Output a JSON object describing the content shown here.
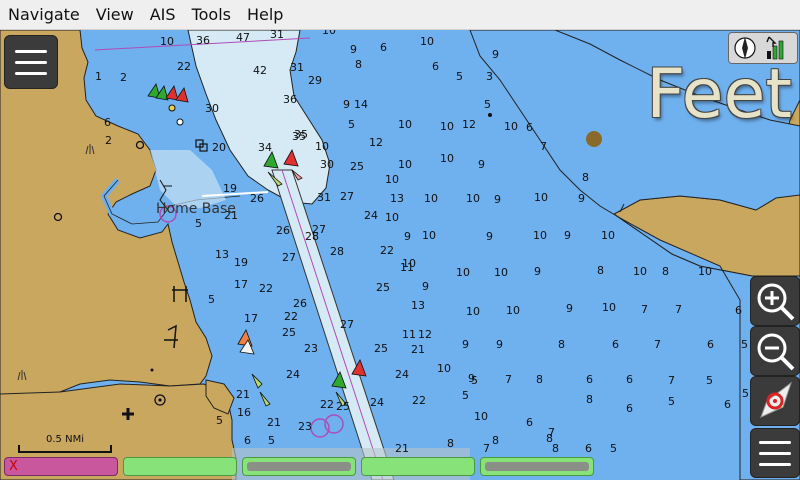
{
  "menu": [
    "Navigate",
    "View",
    "AIS",
    "Tools",
    "Help"
  ],
  "units_overlay": "Feet",
  "scale_label": "0.5 NMi",
  "place_label": "Home Base",
  "piano_close": "X",
  "colors": {
    "deep_water": "#6fb0ee",
    "shallow_water": "#d6eaf5",
    "land": "#c9a75e",
    "piano_magenta": "#c8579e",
    "piano_green": "#88e27a"
  },
  "soundings": [
    [
      "10",
      160,
      45
    ],
    [
      "36",
      196,
      44
    ],
    [
      "47",
      236,
      41
    ],
    [
      "31",
      270,
      38
    ],
    [
      "10",
      322,
      34
    ],
    [
      "9",
      350,
      53
    ],
    [
      "6",
      380,
      51
    ],
    [
      "10",
      420,
      45
    ],
    [
      "6",
      432,
      70
    ],
    [
      "5",
      456,
      80
    ],
    [
      "3",
      486,
      80
    ],
    [
      "5",
      484,
      108
    ],
    [
      "9",
      492,
      58
    ],
    [
      "42",
      253,
      74
    ],
    [
      "31",
      290,
      71
    ],
    [
      "29",
      308,
      84
    ],
    [
      "8",
      355,
      68
    ],
    [
      "22",
      177,
      70
    ],
    [
      "1",
      95,
      80
    ],
    [
      "2",
      120,
      81
    ],
    [
      "36",
      283,
      103
    ],
    [
      "9",
      343,
      108
    ],
    [
      "14",
      354,
      108
    ],
    [
      "5",
      348,
      128
    ],
    [
      "10",
      398,
      128
    ],
    [
      "10",
      440,
      130
    ],
    [
      "12",
      462,
      128
    ],
    [
      "10",
      504,
      130
    ],
    [
      "6",
      526,
      131
    ],
    [
      "30",
      205,
      112
    ],
    [
      "20",
      212,
      151
    ],
    [
      "35",
      292,
      140
    ],
    [
      "35",
      294,
      138
    ],
    [
      "34",
      258,
      151
    ],
    [
      "30",
      320,
      168
    ],
    [
      "10",
      315,
      150
    ],
    [
      "12",
      369,
      146
    ],
    [
      "7",
      540,
      150
    ],
    [
      "25",
      350,
      170
    ],
    [
      "10",
      398,
      168
    ],
    [
      "10",
      385,
      183
    ],
    [
      "8",
      582,
      181
    ],
    [
      "9",
      478,
      168
    ],
    [
      "10",
      440,
      162
    ],
    [
      "2",
      105,
      144
    ],
    [
      "6",
      104,
      126
    ],
    [
      "19",
      223,
      192
    ],
    [
      "26",
      250,
      202
    ],
    [
      "31",
      317,
      201
    ],
    [
      "27",
      340,
      200
    ],
    [
      "13",
      390,
      202
    ],
    [
      "10",
      424,
      202
    ],
    [
      "10",
      466,
      202
    ],
    [
      "9",
      494,
      203
    ],
    [
      "10",
      534,
      201
    ],
    [
      "9",
      578,
      202
    ],
    [
      "24",
      364,
      219
    ],
    [
      "10",
      385,
      221
    ],
    [
      "5",
      195,
      227
    ],
    [
      "21",
      224,
      219
    ],
    [
      "26",
      276,
      234
    ],
    [
      "27",
      312,
      233
    ],
    [
      "28",
      305,
      240
    ],
    [
      "22",
      380,
      254
    ],
    [
      "9",
      404,
      240
    ],
    [
      "10",
      422,
      239
    ],
    [
      "9",
      486,
      240
    ],
    [
      "10",
      533,
      239
    ],
    [
      "9",
      564,
      239
    ],
    [
      "10",
      601,
      239
    ],
    [
      "13",
      215,
      258
    ],
    [
      "19",
      234,
      266
    ],
    [
      "27",
      282,
      261
    ],
    [
      "28",
      330,
      255
    ],
    [
      "10",
      402,
      267
    ],
    [
      "10",
      456,
      276
    ],
    [
      "10",
      494,
      276
    ],
    [
      "9",
      534,
      275
    ],
    [
      "8",
      597,
      274
    ],
    [
      "10",
      633,
      275
    ],
    [
      "8",
      662,
      275
    ],
    [
      "10",
      698,
      275
    ],
    [
      "17",
      234,
      288
    ],
    [
      "22",
      259,
      292
    ],
    [
      "25",
      376,
      291
    ],
    [
      "11",
      400,
      271
    ],
    [
      "13",
      411,
      309
    ],
    [
      "9",
      422,
      290
    ],
    [
      "10",
      466,
      315
    ],
    [
      "10",
      506,
      314
    ],
    [
      "9",
      566,
      312
    ],
    [
      "10",
      602,
      311
    ],
    [
      "7",
      641,
      313
    ],
    [
      "7",
      675,
      313
    ],
    [
      "6",
      735,
      314
    ],
    [
      "5",
      208,
      303
    ],
    [
      "26",
      293,
      307
    ],
    [
      "17",
      244,
      322
    ],
    [
      "22",
      284,
      320
    ],
    [
      "25",
      282,
      336
    ],
    [
      "23",
      304,
      352
    ],
    [
      "27",
      340,
      328
    ],
    [
      "11",
      402,
      338
    ],
    [
      "12",
      418,
      338
    ],
    [
      "9",
      462,
      348
    ],
    [
      "9",
      496,
      348
    ],
    [
      "8",
      558,
      348
    ],
    [
      "6",
      612,
      348
    ],
    [
      "7",
      654,
      348
    ],
    [
      "6",
      707,
      348
    ],
    [
      "5",
      741,
      348
    ],
    [
      "25",
      374,
      352
    ],
    [
      "21",
      411,
      353
    ],
    [
      "24",
      286,
      378
    ],
    [
      "24",
      395,
      378
    ],
    [
      "10",
      437,
      372
    ],
    [
      "9",
      468,
      382
    ],
    [
      "7",
      505,
      383
    ],
    [
      "8",
      536,
      383
    ],
    [
      "6",
      586,
      383
    ],
    [
      "6",
      626,
      383
    ],
    [
      "7",
      668,
      384
    ],
    [
      "5",
      706,
      384
    ],
    [
      "22",
      412,
      404
    ],
    [
      "5",
      471,
      384
    ],
    [
      "5",
      462,
      399
    ],
    [
      "8",
      586,
      403
    ],
    [
      "6",
      626,
      412
    ],
    [
      "5",
      668,
      405
    ],
    [
      "5",
      742,
      397
    ],
    [
      "24",
      370,
      406
    ],
    [
      "10",
      474,
      420
    ],
    [
      "6",
      526,
      426
    ],
    [
      "7",
      548,
      436
    ],
    [
      "8",
      492,
      444
    ],
    [
      "22",
      320,
      408
    ],
    [
      "25",
      336,
      410
    ],
    [
      "21",
      236,
      398
    ],
    [
      "5",
      216,
      424
    ],
    [
      "6",
      244,
      444
    ],
    [
      "5",
      268,
      444
    ],
    [
      "16",
      237,
      416
    ],
    [
      "21",
      267,
      426
    ],
    [
      "23",
      298,
      430
    ],
    [
      "8",
      546,
      442
    ],
    [
      "6",
      724,
      408
    ],
    [
      "21",
      395,
      452
    ],
    [
      "8",
      447,
      447
    ],
    [
      "7",
      483,
      452
    ],
    [
      "8",
      552,
      452
    ],
    [
      "6",
      585,
      452
    ],
    [
      "5",
      610,
      452
    ]
  ]
}
